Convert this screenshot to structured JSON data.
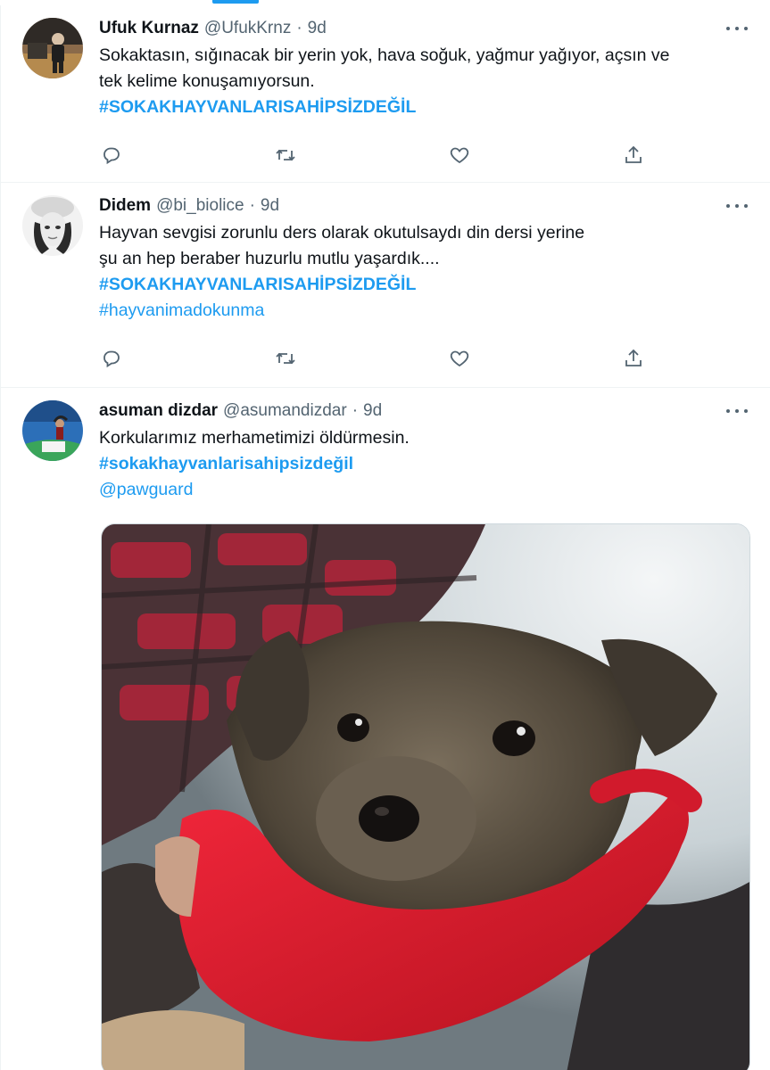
{
  "tweets": [
    {
      "name": "Ufuk Kurnaz",
      "handle": "@UfukKrnz",
      "separator": "·",
      "time": "9d",
      "text_lines": [
        "Sokaktasın, sığınacak bir yerin yok, hava soğuk, yağmur yağıyor, açsın ve",
        "tek kelime konuşamıyorsun."
      ],
      "hashtags": [
        "#SOKAKHAYVANLARISAHİPSİZDEĞİL"
      ]
    },
    {
      "name": "Didem",
      "handle": "@bi_biolice",
      "separator": "·",
      "time": "9d",
      "text_lines": [
        "Hayvan sevgisi zorunlu ders olarak okutulsaydı din dersi yerine",
        "şu an hep beraber huzurlu mutlu yaşardık...."
      ],
      "hashtags": [
        "#SOKAKHAYVANLARISAHİPSİZDEĞİL",
        "#hayvanimadokunma"
      ]
    },
    {
      "name": "asuman dizdar",
      "handle": "@asumandizdar",
      "separator": "·",
      "time": "9d",
      "text_lines": [
        "Korkularımız merhametimizi öldürmesin."
      ],
      "hashtags": [
        "#sokakhayvanlarisahipsizdeğil"
      ],
      "mention": "@pawguard",
      "media": "puppy-photo"
    }
  ],
  "icons": {
    "reply": "reply-icon",
    "retweet": "retweet-icon",
    "like": "like-icon",
    "share": "share-icon",
    "more": "more-options-icon"
  },
  "colors": {
    "link": "#1d9bf0",
    "text": "#0f1419",
    "secondary": "#536471",
    "border": "#eff3f4"
  }
}
